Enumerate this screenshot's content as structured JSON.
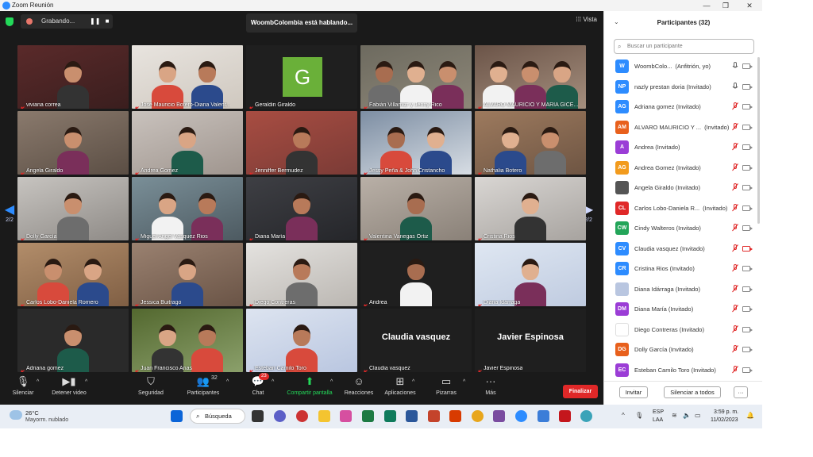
{
  "window": {
    "title": "Zoom Reunión"
  },
  "topbar": {
    "recording_label": "Grabando...",
    "speaking_label": "WoombColombia está hablando...",
    "view_label": "Vista"
  },
  "pager": {
    "left": "2/2",
    "right": "2/2"
  },
  "tiles": [
    "viviana correa",
    "Jose Mauricio Botero-Diana Valent...",
    "Geraldin Giraldo",
    "Fabián Villamizr y Jenny Rico",
    "ALVARO MAURICIO Y MARIA GICE...",
    "Angela Giraldo",
    "Andrea Gomez",
    "Jenniffer Bermudez",
    "Jessy Peña & John Cristancho",
    "Nathalia Botero",
    "Dolly García",
    "Miguel Angel Vasquez Rios",
    "Diana María",
    "Valentina Vanegas Ortiz",
    "Cristina Rios",
    "Carlos Lobo-Daniela Romero",
    "Jessica Buitrago",
    "Diego Contreras",
    "Andrea",
    "Diana Idárraga",
    "Adriana gomez",
    "Juan Francisco Arias",
    "Esteban Camilo Toro",
    "Claudia vasquez",
    "Javier Espinosa"
  ],
  "tile_avatar_letter": "G",
  "tile_big_names": {
    "claudia": "Claudia vasquez",
    "javier": "Javier Espinosa"
  },
  "toolbar": {
    "mute": "Silenciar",
    "video": "Detener video",
    "security": "Seguridad",
    "participants": "Participantes",
    "participants_count": "32",
    "chat": "Chat",
    "chat_badge": "23",
    "share": "Compartir pantalla",
    "reactions": "Reacciones",
    "apps": "Aplicaciones",
    "whiteboards": "Pizarras",
    "more": "Más",
    "end": "Finalizar"
  },
  "panel": {
    "title": "Participantes (32)",
    "search_placeholder": "Buscar un participante",
    "participants": [
      {
        "initials": "W",
        "color": "#2d8cff",
        "name": "WoombColo...",
        "note": "(Anfitrión, yo)"
      },
      {
        "initials": "NP",
        "color": "#2d8cff",
        "name": "nazly prestan doria (Invitado)"
      },
      {
        "initials": "AG",
        "color": "#2d8cff",
        "name": "Adriana gomez (Invitado)"
      },
      {
        "initials": "AM",
        "color": "#e8601c",
        "name": "ALVARO MAURICIO Y ...",
        "note": "(Invitado)"
      },
      {
        "initials": "A",
        "color": "#9b3dd6",
        "name": "Andrea (Invitado)"
      },
      {
        "initials": "AG",
        "color": "#f29b1d",
        "name": "Andrea Gomez (Invitado)"
      },
      {
        "initials": "",
        "color": "#555555",
        "name": "Angela Giraldo (Invitado)"
      },
      {
        "initials": "CL",
        "color": "#e02828",
        "name": "Carlos Lobo-Daniela R...",
        "note": "(Invitado)"
      },
      {
        "initials": "CW",
        "color": "#23a559",
        "name": "Cindy Walteros (Invitado)"
      },
      {
        "initials": "CV",
        "color": "#2d8cff",
        "name": "Claudia vasquez (Invitado)"
      },
      {
        "initials": "CR",
        "color": "#2d8cff",
        "name": "Cristina Rios (Invitado)"
      },
      {
        "initials": "",
        "color": "#b9c6e0",
        "name": "Diana Idárraga (Invitado)"
      },
      {
        "initials": "DM",
        "color": "#9b3dd6",
        "name": "Diana María (Invitado)"
      },
      {
        "initials": "",
        "color": "#ffffff",
        "name": "Diego Contreras (Invitado)"
      },
      {
        "initials": "DG",
        "color": "#e8601c",
        "name": "Dolly García (Invitado)"
      },
      {
        "initials": "EC",
        "color": "#9b3dd6",
        "name": "Esteban Camilo Toro (Invitado)"
      }
    ],
    "invite": "Invitar",
    "mute_all": "Silenciar a todos",
    "more": "···"
  },
  "taskbar": {
    "temperature": "26°C",
    "weather": "Mayorm. nublado",
    "search": "Búsqueda",
    "lang_top": "ESP",
    "lang_bottom": "LAA",
    "time": "3:59 p. m.",
    "date": "11/02/2023"
  }
}
